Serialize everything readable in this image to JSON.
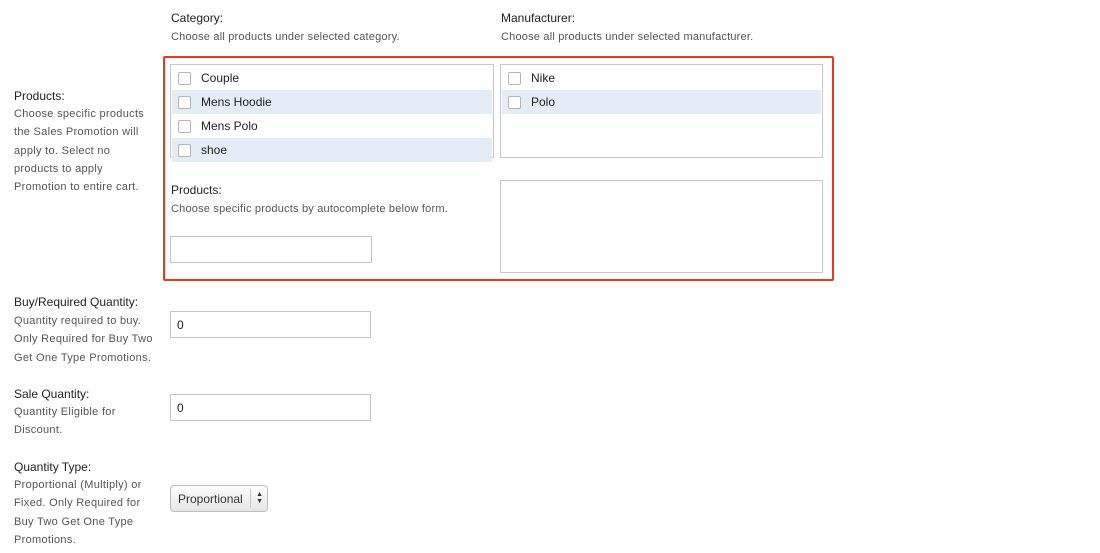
{
  "category": {
    "label": "Category:",
    "help": "Choose all products under selected category.",
    "items": [
      {
        "label": "Couple"
      },
      {
        "label": "Mens Hoodie"
      },
      {
        "label": "Mens Polo"
      },
      {
        "label": "shoe"
      }
    ]
  },
  "manufacturer": {
    "label": "Manufacturer:",
    "help": "Choose all products under selected manufacturer.",
    "items": [
      {
        "label": "Nike"
      },
      {
        "label": "Polo"
      }
    ]
  },
  "products": {
    "side_label": "Products:",
    "side_desc": [
      "Choose specific products",
      "the Sales Promotion will",
      "apply to. Select no",
      "products to apply",
      "Promotion to entire cart."
    ],
    "label": "Products:",
    "help": "Choose specific products by autocomplete below form.",
    "input_value": ""
  },
  "buy_quantity": {
    "label": "Buy/Required Quantity:",
    "desc": [
      "Quantity required to buy.",
      "Only Required for Buy Two",
      "Get One Type Promotions."
    ],
    "value": "0"
  },
  "sale_quantity": {
    "label": "Sale Quantity:",
    "desc": [
      "Quantity Eligible for",
      "Discount."
    ],
    "value": "0"
  },
  "quantity_type": {
    "label": "Quantity Type:",
    "desc": [
      "Proportional (Multiply) or",
      "Fixed. Only Required for",
      "Buy Two Get One Type",
      "Promotions."
    ],
    "selected": "Proportional"
  },
  "colors": {
    "highlight_border": "#e8391e",
    "row_alt": "#e4edf5"
  }
}
